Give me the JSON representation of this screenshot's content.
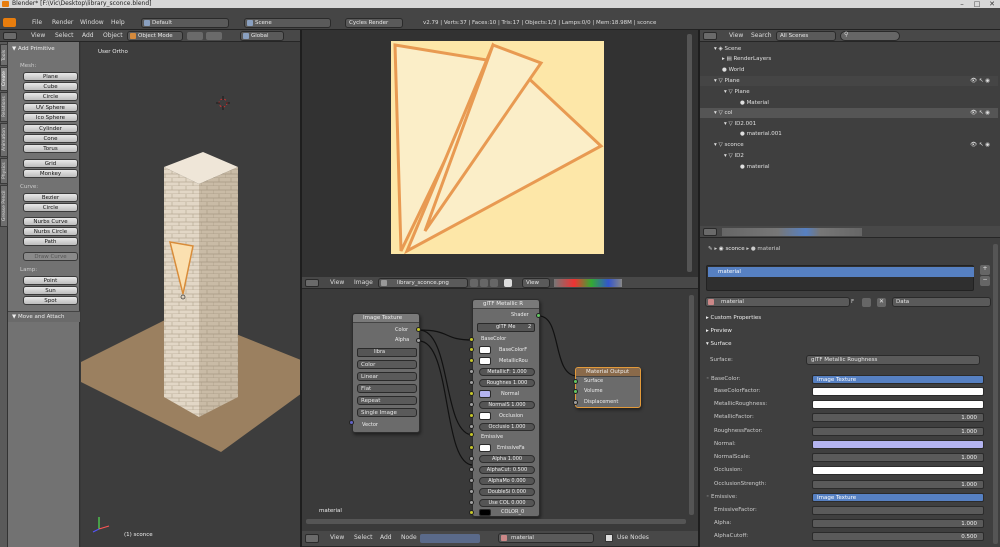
{
  "window": {
    "title": "Blender* [F:\\Vic\\Desktop\\library_sconce.blend]",
    "min": "–",
    "max": "□",
    "close": "✕"
  },
  "topbar": {
    "menus": [
      "File",
      "Render",
      "Window",
      "Help"
    ],
    "layout": "Default",
    "scene": "Scene",
    "engine": "Cycles Render",
    "stats": "v2.79 | Verts:37 | Faces:10 | Tris:17 | Objects:1/3 | Lamps:0/0 | Mem:18.98M | sconce"
  },
  "viewport_header": {
    "menus": [
      "View",
      "Select",
      "Add",
      "Object"
    ],
    "mode": "Object Mode",
    "orientation": "Global"
  },
  "tool_tabs": [
    "Tools",
    "Create",
    "Relations",
    "Animation",
    "Physics",
    "Grease Pencil"
  ],
  "toolshelf": {
    "panel_title": "Add Primitive",
    "mesh_label": "Mesh:",
    "mesh": [
      "Plane",
      "Cube",
      "Circle",
      "UV Sphere",
      "Ico Sphere",
      "Cylinder",
      "Cone",
      "Torus"
    ],
    "mesh2": [
      "Grid",
      "Monkey"
    ],
    "curve_label": "Curve:",
    "curve": [
      "Bezier",
      "Circle"
    ],
    "curve2": [
      "Nurbs Curve",
      "Nurbs Circle",
      "Path"
    ],
    "draw_curve": "Draw Curve",
    "lamp_label": "Lamp:",
    "lamp": [
      "Point",
      "Sun",
      "Spot"
    ],
    "move_panel": "Move and Attach"
  },
  "viewport": {
    "view_name": "User Ortho",
    "object_info": "(1) sconce"
  },
  "image_editor": {
    "menus": [
      "View",
      "Image"
    ],
    "image": "library_sconce.png",
    "view": "View"
  },
  "node_editor": {
    "menus": [
      "View",
      "Select",
      "Add",
      "Node"
    ],
    "material": "material",
    "use_nodes": "Use Nodes",
    "material_label": "material",
    "image_node": {
      "title": "Image Texture",
      "out_color": "Color",
      "out_alpha": "Alpha",
      "image": "libra",
      "opts": [
        "Color",
        "Linear",
        "Flat",
        "Repeat",
        "Single Image"
      ],
      "in_vector": "Vector"
    },
    "gltf_node": {
      "title": "glTF Metallic R",
      "out_shader": "Shader",
      "group": "glTF Me",
      "users": "2",
      "base_color": "BaseColor",
      "base_color_f": "BaseColorF",
      "metallic_rough": "MetallicRou",
      "metallic_f": "MetallicF: 1.000",
      "roughness_f": "Roughnes 1.000",
      "normal": "Normal",
      "normal_s": "NormalS 1.000",
      "occlusion": "Occlusion",
      "occlusion_s": "Occlusio 1.000",
      "emissive": "Emissive",
      "emissive_f": "EmissiveFa",
      "alpha": "Alpha       1.000",
      "alpha_cut": "AlphaCut: 0.500",
      "alpha_mode": "AlphaMo 0.000",
      "double_sided": "DoubleSi 0.000",
      "use_color": "Use COL 0.000",
      "color0": "COLOR_0"
    },
    "output_node": {
      "title": "Material Output",
      "surface": "Surface",
      "volume": "Volume",
      "displacement": "Displacement"
    }
  },
  "outliner": {
    "menus": [
      "View",
      "Search"
    ],
    "filter": "All Scenes",
    "rows": [
      "Scene",
      "RenderLayers",
      "World",
      "Plane",
      "Plane",
      "Material",
      "col",
      "ID2.001",
      "material.001",
      "sconce",
      "ID2",
      "material"
    ]
  },
  "properties": {
    "breadcrumb_obj": "sconce",
    "breadcrumb_mat": "material",
    "slot": "material",
    "mat_name": "material",
    "mat_users": "F",
    "data": "Data",
    "panels": [
      "Custom Properties",
      "Preview",
      "Surface"
    ],
    "surface_label": "Surface:",
    "surface_value": "glTF Metallic Roughness",
    "fields": [
      {
        "label": "BaseColor:",
        "value": "Image Texture"
      },
      {
        "label": "BaseColorFactor:",
        "value": ""
      },
      {
        "label": "MetallicRoughness:",
        "value": ""
      },
      {
        "label": "MetallicFactor:",
        "value": "1.000"
      },
      {
        "label": "RoughnessFactor:",
        "value": "1.000"
      },
      {
        "label": "Normal:",
        "value": ""
      },
      {
        "label": "NormalScale:",
        "value": "1.000"
      },
      {
        "label": "Occlusion:",
        "value": ""
      },
      {
        "label": "OcclusionStrength:",
        "value": "1.000"
      },
      {
        "label": "Emissive:",
        "value": "Image Texture"
      },
      {
        "label": "EmissiveFactor:",
        "value": ""
      },
      {
        "label": "Alpha:",
        "value": "1.000"
      },
      {
        "label": "AlphaCutoff:",
        "value": "0.500"
      }
    ]
  },
  "colors": {
    "accent": "#5680c2",
    "texture_bg": "#fde6a8",
    "texture_line": "#e89a52",
    "normal": "#b4b4f0"
  }
}
